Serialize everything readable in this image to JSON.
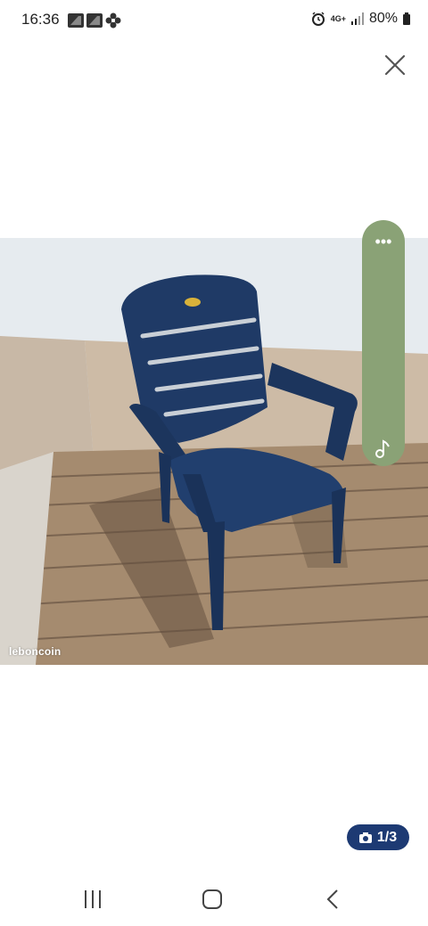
{
  "status_bar": {
    "time": "16:36",
    "network": "4G+",
    "battery": "80%",
    "left_icons": [
      "notification-icon",
      "notification-icon",
      "pinwheel-icon"
    ],
    "right_icons": [
      "alarm-icon",
      "signal-icon",
      "battery-icon"
    ]
  },
  "viewer": {
    "close_icon": "close-icon",
    "watermark": "leboncoin",
    "counter_text": "1/3",
    "counter_icon": "camera-icon"
  },
  "side_panel": {
    "color": "#8aa276",
    "menu_icon": "more-dots-icon",
    "music_icon": "music-note-icon"
  },
  "nav_bar": {
    "items": [
      "recent-apps-icon",
      "home-icon",
      "back-icon"
    ]
  },
  "colors": {
    "chair": "#1f3a66",
    "badge": "#1d3a73",
    "side_panel": "#8aa276"
  }
}
